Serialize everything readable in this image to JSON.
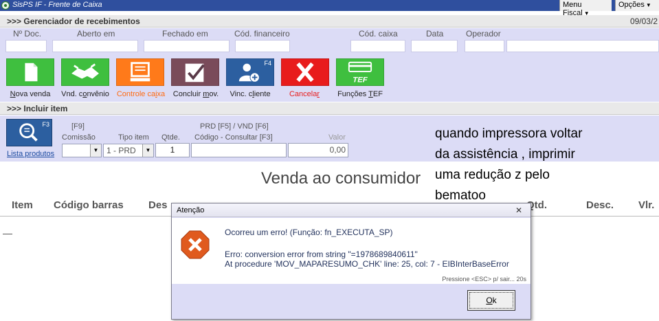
{
  "window": {
    "title": "SisPS IF - Frente de Caixa",
    "menu_fiscal": "Menu Fiscal",
    "opcoes": "Opções"
  },
  "gerenciador": {
    "header": ">>> Gerenciador de recebimentos",
    "date": "09/03/2",
    "labels": {
      "num_doc": "Nº Doc.",
      "aberto_em": "Aberto em",
      "fechado_em": "Fechado em",
      "cod_financeiro": "Cód. financeiro",
      "cod_caixa": "Cód. caixa",
      "data": "Data",
      "operador": "Operador"
    }
  },
  "toolbar": {
    "nova_venda": {
      "pre": "",
      "key": "N",
      "post": "ova venda",
      "color": "#3fbf3f"
    },
    "vnd_convenio": {
      "pre": "Vnd. c",
      "key": "o",
      "post": "nvênio",
      "color": "#3fbf3f"
    },
    "controle_caixa": {
      "pre": "Controle ca",
      "key": "i",
      "post": "xa",
      "color": "#ff7a1a"
    },
    "concluir_mov": {
      "pre": "Concluir ",
      "key": "m",
      "post": "ov.",
      "color": "#7a4b5a"
    },
    "vinc_cliente": {
      "pre": "Vinc. c",
      "key": "l",
      "post": "iente",
      "color": "#2c5fa0",
      "shortcut": "F4"
    },
    "cancelar": {
      "pre": "Cancela",
      "key": "r",
      "post": "",
      "color": "#e81c1c"
    },
    "funcoes_tef": {
      "pre": "Funções ",
      "key": "T",
      "post": "EF",
      "color": "#3fbf3f",
      "icon_text": "TEF"
    }
  },
  "incluir": {
    "header": ">>> Incluir item",
    "search_shortcut": "F3",
    "lista_produtos": "Lista produtos",
    "comissao_key": "[F9]",
    "comissao": "Comissão",
    "tipo_item": "Tipo item",
    "tipo_item_value": "1 - PRD",
    "qtde": "Qtde.",
    "qtde_value": "1",
    "prd_vnd": "PRD [F5] / VND [F6]",
    "codigo": "Código - Consultar [F3]",
    "valor": "Valor",
    "valor_value": "0,00"
  },
  "main": {
    "title": "Venda ao consumidor",
    "columns": {
      "item": "Item",
      "codigo_barras": "Código barras",
      "des": "Des",
      "qtd": "Qtd.",
      "desc": "Desc.",
      "vlr": "Vlr."
    }
  },
  "annotation": "quando impressora voltar\nda assistência , imprimir\numa redução z pelo\nbematoo",
  "dialog": {
    "title": "Atenção",
    "line1": "Ocorreu um erro! (Função: fn_EXECUTA_SP)",
    "line2": "Erro: conversion error from string \"=1978689840611\"",
    "line3": "At procedure 'MOV_MAPARESUMO_CHK' line: 25, col: 7 - EIBInterBaseError",
    "hint": "Pressione <ESC> p/ sair... 20s",
    "ok_key": "O",
    "ok_rest": "k"
  }
}
